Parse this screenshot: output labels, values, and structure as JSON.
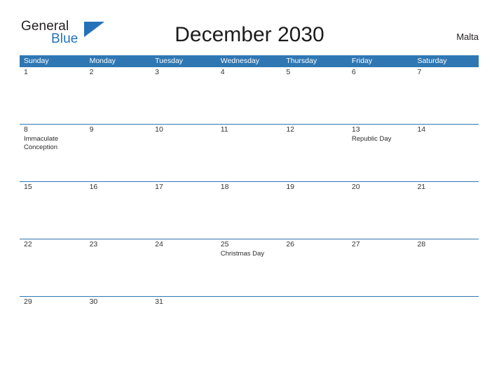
{
  "brand": {
    "name_part1": "General",
    "name_part2": "Blue",
    "logo_icon": "triangle-flag-icon",
    "accent_color": "#2372b9"
  },
  "header": {
    "title": "December 2030",
    "country": "Malta"
  },
  "calendar": {
    "month": "December",
    "year": "2030",
    "header_bg_color": "#2f77b3",
    "band_color": "#f0f0f0",
    "weekdays": [
      "Sunday",
      "Monday",
      "Tuesday",
      "Wednesday",
      "Thursday",
      "Friday",
      "Saturday"
    ],
    "weeks": [
      [
        {
          "day": "1",
          "event": ""
        },
        {
          "day": "2",
          "event": ""
        },
        {
          "day": "3",
          "event": ""
        },
        {
          "day": "4",
          "event": ""
        },
        {
          "day": "5",
          "event": ""
        },
        {
          "day": "6",
          "event": ""
        },
        {
          "day": "7",
          "event": ""
        }
      ],
      [
        {
          "day": "8",
          "event": "Immaculate Conception"
        },
        {
          "day": "9",
          "event": ""
        },
        {
          "day": "10",
          "event": ""
        },
        {
          "day": "11",
          "event": ""
        },
        {
          "day": "12",
          "event": ""
        },
        {
          "day": "13",
          "event": "Republic Day"
        },
        {
          "day": "14",
          "event": ""
        }
      ],
      [
        {
          "day": "15",
          "event": ""
        },
        {
          "day": "16",
          "event": ""
        },
        {
          "day": "17",
          "event": ""
        },
        {
          "day": "18",
          "event": ""
        },
        {
          "day": "19",
          "event": ""
        },
        {
          "day": "20",
          "event": ""
        },
        {
          "day": "21",
          "event": ""
        }
      ],
      [
        {
          "day": "22",
          "event": ""
        },
        {
          "day": "23",
          "event": ""
        },
        {
          "day": "24",
          "event": ""
        },
        {
          "day": "25",
          "event": "Christmas Day"
        },
        {
          "day": "26",
          "event": ""
        },
        {
          "day": "27",
          "event": ""
        },
        {
          "day": "28",
          "event": ""
        }
      ],
      [
        {
          "day": "29",
          "event": ""
        },
        {
          "day": "30",
          "event": ""
        },
        {
          "day": "31",
          "event": ""
        },
        {
          "day": "",
          "event": ""
        },
        {
          "day": "",
          "event": ""
        },
        {
          "day": "",
          "event": ""
        },
        {
          "day": "",
          "event": ""
        }
      ]
    ]
  }
}
